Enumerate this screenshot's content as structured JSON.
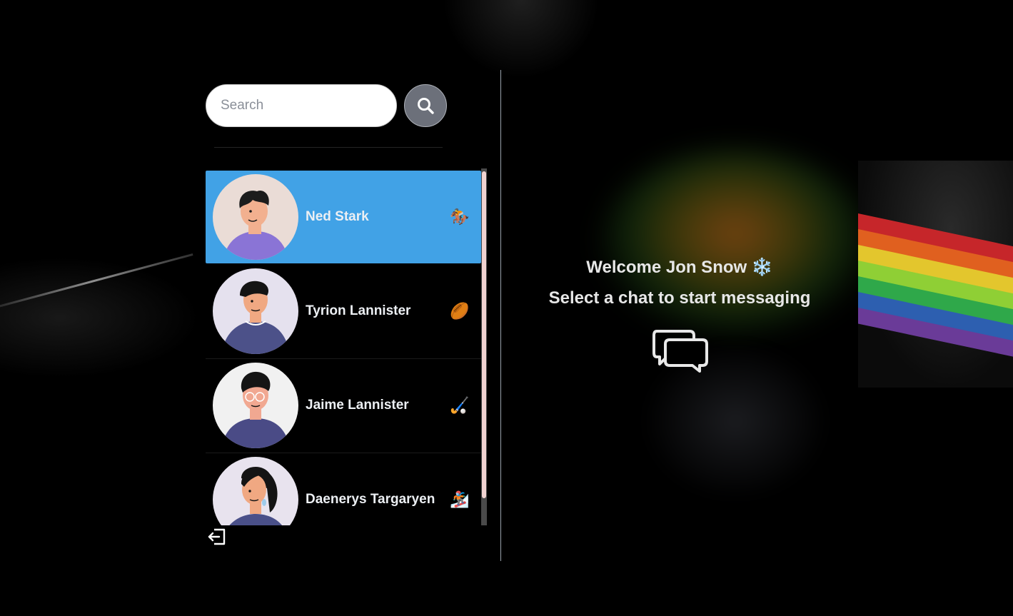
{
  "search": {
    "placeholder": "Search",
    "button_icon": "search-icon"
  },
  "conversations": [
    {
      "name": "Ned Stark",
      "emoji": "🏇",
      "active": true,
      "avatar_bg": "#eadcd6",
      "shirt": "#8a74d6",
      "skin": "#f2b08f",
      "hair": "#1c1c1c"
    },
    {
      "name": "Tyrion Lannister",
      "emoji": "🏉",
      "active": false,
      "avatar_bg": "#e5e1ee",
      "shirt": "#4c5189",
      "skin": "#f0a882",
      "hair": "#141414"
    },
    {
      "name": "Jaime Lannister",
      "emoji": "🏑",
      "active": false,
      "avatar_bg": "#f1f1f1",
      "shirt": "#4a4b86",
      "skin": "#f1a891",
      "hair": "#151515"
    },
    {
      "name": "Daenerys Targaryen",
      "emoji": "🏂",
      "active": false,
      "avatar_bg": "#e8e3ee",
      "shirt": "#4a5089",
      "skin": "#f0a882",
      "hair": "#141414"
    }
  ],
  "welcome": {
    "greeting": "Welcome Jon Snow ❄️",
    "subtitle": "Select a chat to start messaging",
    "icon": "chat-bubbles-icon"
  },
  "logout": {
    "icon": "logout-icon"
  },
  "colors": {
    "accent": "#41a2e6",
    "search_button": "#6c707a",
    "scroll_thumb": "#f1d3d1"
  }
}
